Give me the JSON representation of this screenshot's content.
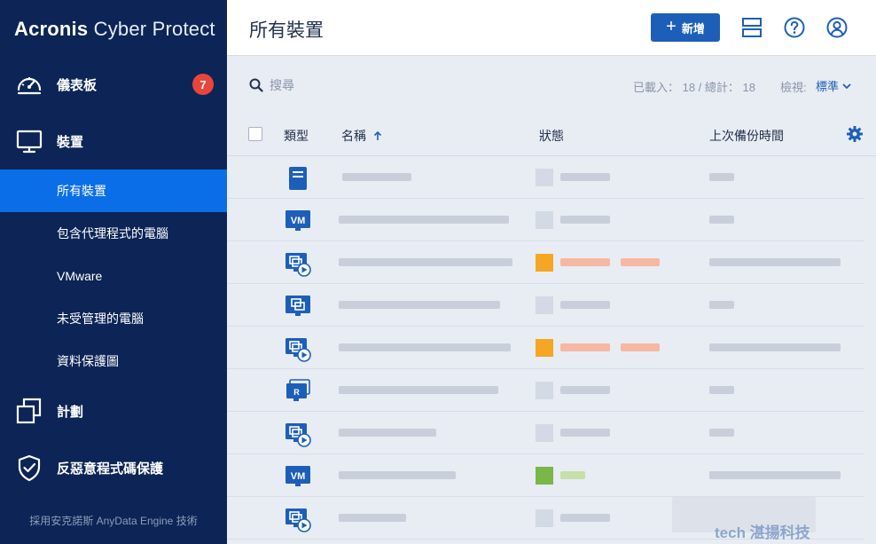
{
  "app": {
    "brand_bold": "Acronis",
    "brand_light": "Cyber Protect"
  },
  "sidebar": {
    "items": [
      {
        "label": "儀表板",
        "badge": "7"
      },
      {
        "label": "裝置"
      },
      {
        "label": "所有裝置"
      },
      {
        "label": "包含代理程式的電腦"
      },
      {
        "label": "VMware"
      },
      {
        "label": "未受管理的電腦"
      },
      {
        "label": "資料保護圖"
      },
      {
        "label": "計劃"
      },
      {
        "label": "反惡意程式碼保護"
      }
    ],
    "footer": "採用安克諾斯 AnyData Engine 技術"
  },
  "header": {
    "title": "所有裝置",
    "add_label": "新增"
  },
  "toolbar": {
    "search_placeholder": "搜尋",
    "counts": "已載入： 18 / 總計： 18",
    "view_label": "檢視:",
    "view_value": "標準"
  },
  "table": {
    "columns": [
      "類型",
      "名稱",
      "狀態",
      "上次備份時間"
    ],
    "rows": [
      {
        "type": "server-icon"
      },
      {
        "type": "vm-icon"
      },
      {
        "type": "virtual-machine-icon"
      },
      {
        "type": "physical-machine-icon"
      },
      {
        "type": "virtual-machine-icon"
      },
      {
        "type": "replica-icon"
      },
      {
        "type": "virtual-machine-icon"
      },
      {
        "type": "vm-icon"
      },
      {
        "type": "virtual-machine-icon"
      }
    ]
  },
  "colors": {
    "accent": "#1d5fb8",
    "sidebar": "#0c2556",
    "active": "#0a6ee8",
    "badge": "#e8453c",
    "warning": "#f5a623",
    "ok": "#7ab648"
  },
  "watermark": "tech 湛揚科技"
}
